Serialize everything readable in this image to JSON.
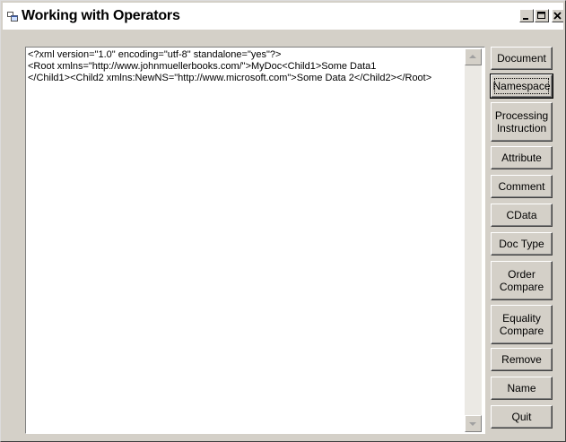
{
  "window": {
    "title": "Working with Operators"
  },
  "textarea": {
    "content": "<?xml version=\"1.0\" encoding=\"utf-8\" standalone=\"yes\"?>\n<Root xmlns=\"http://www.johnmuellerbooks.com/\">MyDoc<Child1>Some Data1\n</Child1><Child2 xmlns:NewNS=\"http://www.microsoft.com\">Some Data 2</Child2></Root>"
  },
  "buttons": {
    "document": "Document",
    "namespace": "Namespace",
    "processing_instruction": "Processing\nInstruction",
    "attribute": "Attribute",
    "comment": "Comment",
    "cdata": "CData",
    "doc_type": "Doc Type",
    "order_compare": "Order\nCompare",
    "equality_compare": "Equality\nCompare",
    "remove": "Remove",
    "name": "Name",
    "quit": "Quit"
  },
  "focused_button": "Namespace"
}
